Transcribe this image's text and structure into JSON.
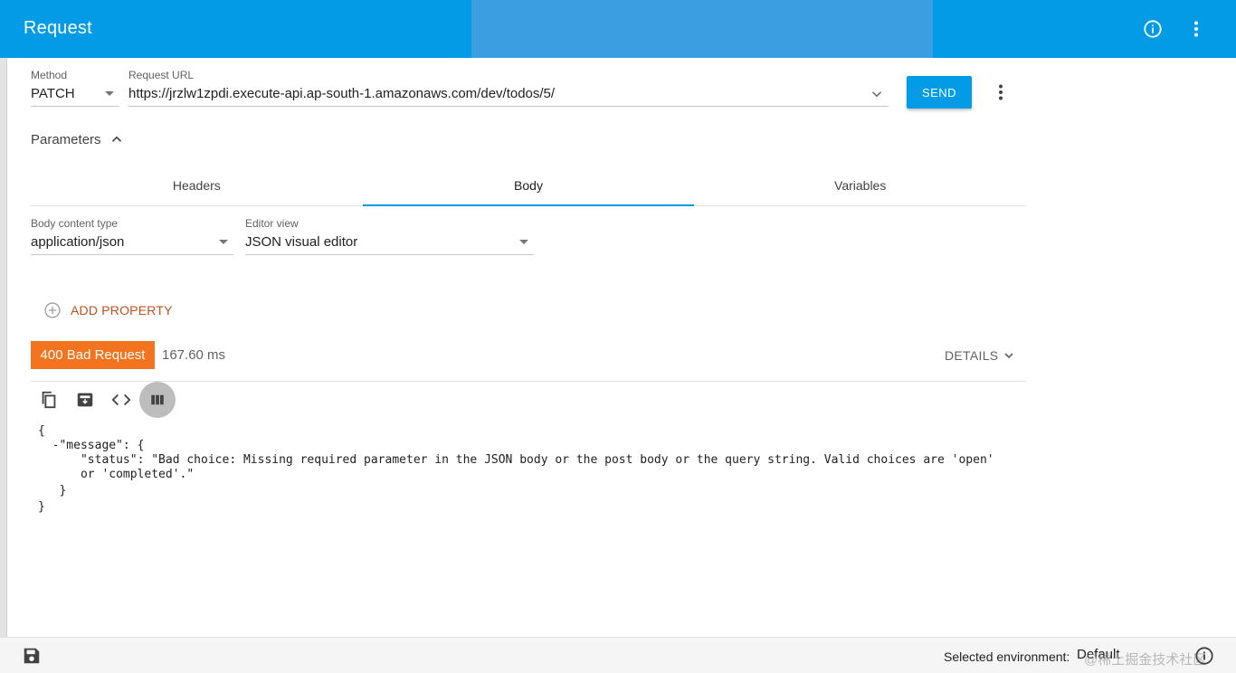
{
  "appbar": {
    "title": "Request",
    "info_icon": "info-circle-icon",
    "menu_icon": "kebab-menu-icon",
    "background": "#039be5"
  },
  "request": {
    "method_label": "Method",
    "method_value": "PATCH",
    "url_label": "Request URL",
    "url_value": "https://jrzlw1zpdi.execute-api.ap-south-1.amazonaws.com/dev/todos/5/",
    "send_label": "SEND"
  },
  "parameters": {
    "label": "Parameters",
    "tabs": [
      {
        "label": "Headers",
        "active": false
      },
      {
        "label": "Body",
        "active": true
      },
      {
        "label": "Variables",
        "active": false
      }
    ],
    "body_content_type_label": "Body content type",
    "body_content_type_value": "application/json",
    "editor_view_label": "Editor view",
    "editor_view_value": "JSON visual editor",
    "add_property_label": "ADD PROPERTY"
  },
  "response": {
    "status": "400 Bad Request",
    "status_color": "#f4731f",
    "time": "167.60 ms",
    "details_label": "DETAILS",
    "json_lines": [
      "{",
      "  -\"message\": {",
      "      \"status\": \"Bad choice: Missing required parameter in the JSON body or the post body or the query string. Valid choices are 'open'",
      "      or 'completed'.\"",
      "   }",
      "}"
    ]
  },
  "bottombar": {
    "env_label": "Selected environment:",
    "env_value": "Default",
    "watermark": "@稀土掘金技术社区"
  }
}
